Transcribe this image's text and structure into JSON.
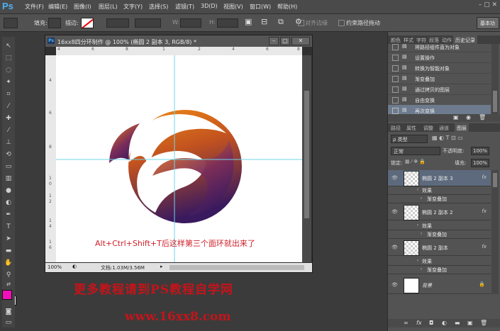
{
  "menubar": {
    "logo": "Ps",
    "items": [
      "文件(F)",
      "编辑(E)",
      "图像(I)",
      "图层(L)",
      "文字(Y)",
      "选择(S)",
      "滤镜(T)",
      "3D(D)",
      "视图(V)",
      "窗口(W)",
      "帮助(H)"
    ],
    "controls": "– ▢ ✕"
  },
  "options": {
    "fill_label": "填充:",
    "stroke_label": "描边:",
    "w_label": "W:",
    "h_label": "H:",
    "align_edges": "对齐边缘",
    "constrain_path": "约束路径拖动",
    "workspace": "基本功"
  },
  "document": {
    "title": "16xx8四分环制作 @ 100% (椭圆 2 副本 3, RGB/8) *",
    "zoom": "100%",
    "doc_size": "文档:1.03M/3.56M",
    "overlay_text": "Alt+Ctrl+Shift+T后这样第三个面环就出来了",
    "ruler_top": [
      "4",
      "6",
      "8",
      "1",
      "2",
      "4",
      "6",
      "8"
    ],
    "ruler_left": [
      "4",
      "6",
      "8",
      "1",
      "0",
      "1",
      "2",
      "1",
      "4",
      "1",
      "6",
      "1",
      "8"
    ]
  },
  "history": {
    "tabs": [
      "颜色",
      "样式",
      "字符",
      "段落",
      "动作",
      "历史记录"
    ],
    "items": [
      "将路径组件直为对象",
      "设置操作",
      "转换为智能对象",
      "渐变叠加",
      "通过拷贝的图层",
      "自由变换",
      "再次变换"
    ],
    "selected_index": 6
  },
  "layers_panel": {
    "tabs": [
      "路径",
      "属性",
      "调整",
      "通道",
      "图层"
    ],
    "filter_label": "ρ 类型",
    "blend_mode": "正常",
    "opacity_label": "不透明度:",
    "opacity_value": "100%",
    "lock_label": "锁定:",
    "fill_label": "填充:",
    "fill_value": "100%",
    "layers": [
      {
        "name": "椭圆 2 副本 3",
        "effect_header": "效果",
        "effect": "渐变叠加",
        "fx": "fx"
      },
      {
        "name": "椭圆 2 副本 2",
        "effect_header": "效果",
        "effect": "渐变叠加",
        "fx": "fx"
      },
      {
        "name": "椭圆 2 副本",
        "effect_header": "效果",
        "effect": "渐变叠加",
        "fx": "fx"
      },
      {
        "name": "背景"
      }
    ]
  },
  "footer": {
    "line1": "更多教程请到PS教程自学网",
    "line2": "www.16xx8.com"
  },
  "colors": {
    "overlay_text": "#d0202a",
    "footer_text": "#c4141a",
    "gradient_orange": "#f08a16",
    "gradient_purple": "#3a1a5e",
    "guide": "#6fd6e8",
    "foreground_swatch": "#f00fb8"
  }
}
